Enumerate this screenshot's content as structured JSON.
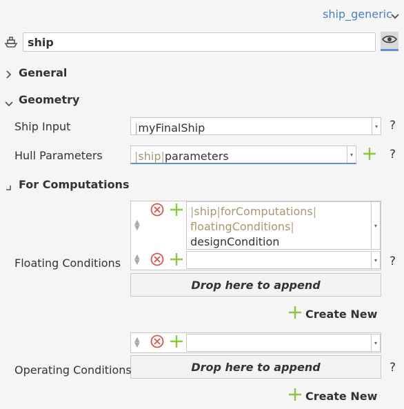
{
  "header": {
    "type_name": "ship_generic"
  },
  "name_field": {
    "value": "ship"
  },
  "sections": {
    "general": "General",
    "geometry": "Geometry",
    "for_computations": "For Computations"
  },
  "ship_input": {
    "label": "Ship Input",
    "value": "myFinalShip"
  },
  "hull_parameters": {
    "label": "Hull Parameters",
    "path_prefix": "ship",
    "value": "parameters"
  },
  "floating_conditions": {
    "label": "Floating Conditions",
    "item1": {
      "path_a": "ship",
      "path_b": "forComputations",
      "path_c": "floatingConditions",
      "value": "designCondition"
    },
    "item2": {
      "value": ""
    },
    "drop_text": "Drop here to append",
    "create_label": "Create New"
  },
  "operating_conditions": {
    "label": "Operating Conditions",
    "item1": {
      "value": ""
    },
    "drop_text": "Drop here to append",
    "create_label": "Create New"
  },
  "help": "?",
  "icons": {
    "chevron": "chevron-down-icon",
    "ship": "ship-icon",
    "eye": "eye-icon",
    "remove": "remove-circle-icon",
    "add": "plus-icon",
    "sort": "sort-handle-icon"
  },
  "colors": {
    "accent_link": "#4a7fc1",
    "add_green": "#8cc63f",
    "remove_red": "#d9534f",
    "path_text": "#a69770"
  }
}
